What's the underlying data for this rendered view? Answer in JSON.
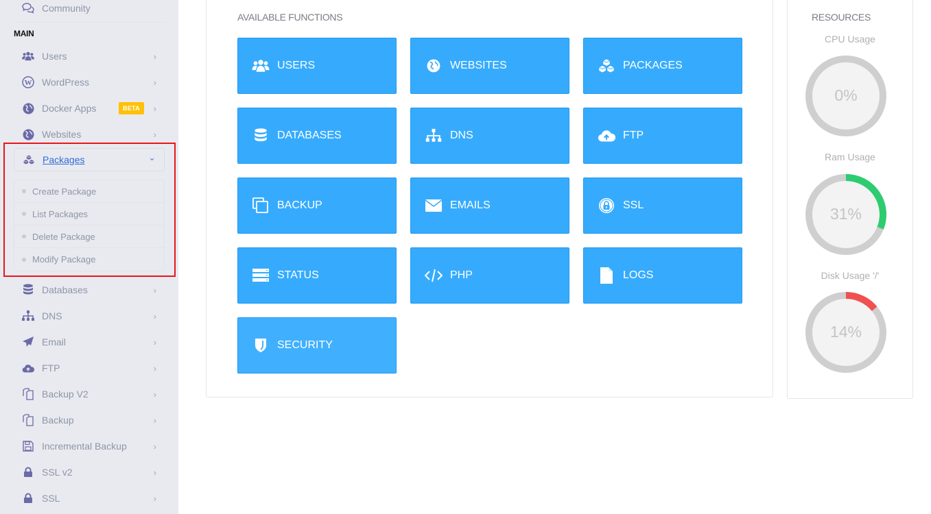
{
  "sidebar": {
    "top_item": {
      "label": "Community",
      "icon": "comments-icon"
    },
    "section_header": "MAIN",
    "items": [
      {
        "label": "Users",
        "icon": "users-icon"
      },
      {
        "label": "WordPress",
        "icon": "wordpress-icon"
      },
      {
        "label": "Docker Apps",
        "icon": "globe-icon",
        "badge": "BETA"
      },
      {
        "label": "Websites",
        "icon": "globe-icon"
      },
      {
        "label": "Packages",
        "icon": "cubes-icon",
        "expanded": true
      },
      {
        "label": "Databases",
        "icon": "database-icon"
      },
      {
        "label": "DNS",
        "icon": "sitemap-icon"
      },
      {
        "label": "Email",
        "icon": "paper-plane-icon"
      },
      {
        "label": "FTP",
        "icon": "cloud-upload-icon"
      },
      {
        "label": "Backup V2",
        "icon": "copy-icon"
      },
      {
        "label": "Backup",
        "icon": "copy-icon"
      },
      {
        "label": "Incremental Backup",
        "icon": "floppy-icon"
      },
      {
        "label": "SSL v2",
        "icon": "lock-icon"
      },
      {
        "label": "SSL",
        "icon": "lock-icon"
      }
    ],
    "packages_submenu": [
      "Create Package",
      "List Packages",
      "Delete Package",
      "Modify Package"
    ],
    "chevron": "›",
    "chevron_down": "⌄"
  },
  "functions": {
    "title": "AVAILABLE FUNCTIONS",
    "buttons": [
      {
        "label": "USERS",
        "icon": "users-icon"
      },
      {
        "label": "WEBSITES",
        "icon": "globe-icon"
      },
      {
        "label": "PACKAGES",
        "icon": "cubes-icon"
      },
      {
        "label": "DATABASES",
        "icon": "database-icon"
      },
      {
        "label": "DNS",
        "icon": "sitemap-icon"
      },
      {
        "label": "FTP",
        "icon": "cloud-upload-icon"
      },
      {
        "label": "BACKUP",
        "icon": "copy-icon"
      },
      {
        "label": "EMAILS",
        "icon": "envelope-icon"
      },
      {
        "label": "SSL",
        "icon": "lock-circle-icon"
      },
      {
        "label": "STATUS",
        "icon": "server-icon"
      },
      {
        "label": "PHP",
        "icon": "code-icon"
      },
      {
        "label": "LOGS",
        "icon": "file-icon"
      },
      {
        "label": "SECURITY",
        "icon": "shield-icon"
      }
    ],
    "button_color": "#36abfd"
  },
  "resources": {
    "title": "RESOURCES",
    "gauges": [
      {
        "label": "CPU Usage",
        "value": 0,
        "display": "0%",
        "color": "#2ecc71"
      },
      {
        "label": "Ram Usage",
        "value": 31,
        "display": "31%",
        "color": "#2ecc71"
      },
      {
        "label": "Disk Usage '/'",
        "value": 14,
        "display": "14%",
        "color": "#f05050"
      }
    ]
  }
}
